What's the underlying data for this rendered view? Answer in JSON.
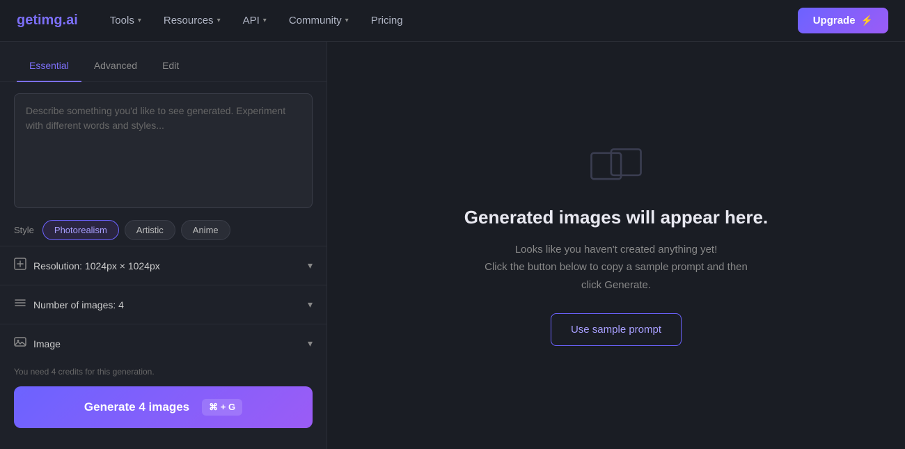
{
  "nav": {
    "logo_text": "getimg.ai",
    "logo_dot": ".",
    "items": [
      {
        "label": "Tools",
        "id": "tools"
      },
      {
        "label": "Resources",
        "id": "resources"
      },
      {
        "label": "API",
        "id": "api"
      },
      {
        "label": "Community",
        "id": "community"
      },
      {
        "label": "Pricing",
        "id": "pricing",
        "no_chevron": true
      }
    ],
    "upgrade_label": "Upgrade"
  },
  "left_panel": {
    "tabs": [
      {
        "label": "Essential",
        "id": "essential",
        "active": true
      },
      {
        "label": "Advanced",
        "id": "advanced"
      },
      {
        "label": "Edit",
        "id": "edit"
      }
    ],
    "prompt_placeholder": "Describe something you'd like to see generated. Experiment with different words and styles...",
    "style_label": "Style",
    "styles": [
      {
        "label": "Photorealism",
        "active": true
      },
      {
        "label": "Artistic",
        "active": false
      },
      {
        "label": "Anime",
        "active": false
      }
    ],
    "accordion_items": [
      {
        "id": "resolution",
        "icon": "⊞",
        "label": "Resolution: 1024px × 1024px"
      },
      {
        "id": "num-images",
        "icon": "≡",
        "label": "Number of images: 4"
      },
      {
        "id": "image",
        "icon": "🖼",
        "label": "Image"
      }
    ],
    "credits_text": "You need 4 credits for this generation.",
    "generate_label": "Generate 4 images",
    "shortcut_label": "⌘ + G"
  },
  "right_panel": {
    "title_part1": "Generated images will appear here.",
    "description": "Looks like you haven't created anything yet!\nClick the button below to copy a sample prompt and then click Generate.",
    "sample_btn_label": "Use sample prompt"
  }
}
